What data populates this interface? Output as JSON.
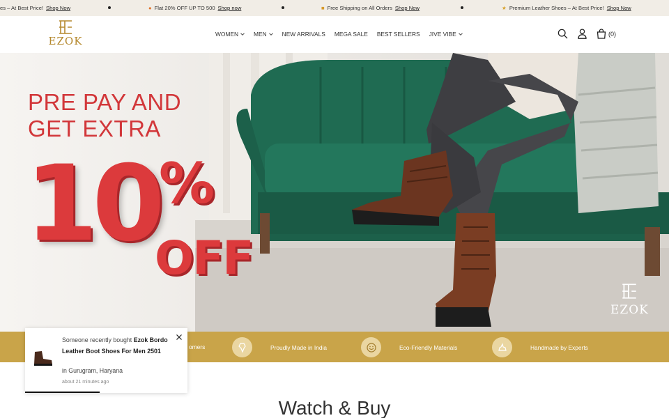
{
  "announcement": {
    "items": [
      {
        "text": "es – At Best Price!",
        "link": "Shop Now"
      },
      {
        "icon": "fire-icon",
        "text": "Flat 20% OFF UP TO 500",
        "link": "Shop now"
      },
      {
        "icon": "truck-icon",
        "text": "Free Shipping on All Orders",
        "link": "Shop Now"
      },
      {
        "icon": "medal-icon",
        "text": "Premium Leather Shoes – At Best Price!",
        "link": "Shop Now"
      }
    ]
  },
  "header": {
    "logo_text": "EZOK",
    "nav": [
      {
        "label": "WOMEN",
        "dropdown": true
      },
      {
        "label": "MEN",
        "dropdown": true
      },
      {
        "label": "NEW ARRIVALS",
        "dropdown": false
      },
      {
        "label": "MEGA SALE",
        "dropdown": false
      },
      {
        "label": "BEST SELLERS",
        "dropdown": false
      },
      {
        "label": "JIVE VIBE",
        "dropdown": true
      }
    ],
    "cart_count": "(0)"
  },
  "hero": {
    "line1": "PRE PAY AND",
    "line2": "GET EXTRA",
    "number": "10",
    "percent": "%",
    "off": "OFF",
    "logo_text": "EZOK"
  },
  "features": {
    "partial_label": "omers",
    "items": [
      {
        "icon": "india-map-icon",
        "label": "Proudly Made in India"
      },
      {
        "icon": "eco-leaf-icon",
        "label": "Eco-Friendly Materials"
      },
      {
        "icon": "hand-craft-icon",
        "label": "Handmade by Experts"
      }
    ]
  },
  "section": {
    "title": "Watch & Buy"
  },
  "toast": {
    "prefix": "Someone recently bought ",
    "product": "Ezok Bordo Leather Boot Shoes For Men 2501",
    "location": "in Gurugram, Haryana",
    "time": "about 21 minutes ago"
  },
  "colors": {
    "accent": "#c9a449",
    "sale_red": "#dc3a3c",
    "brand_gold": "#b5892f",
    "sofa_green": "#1f6b52"
  }
}
